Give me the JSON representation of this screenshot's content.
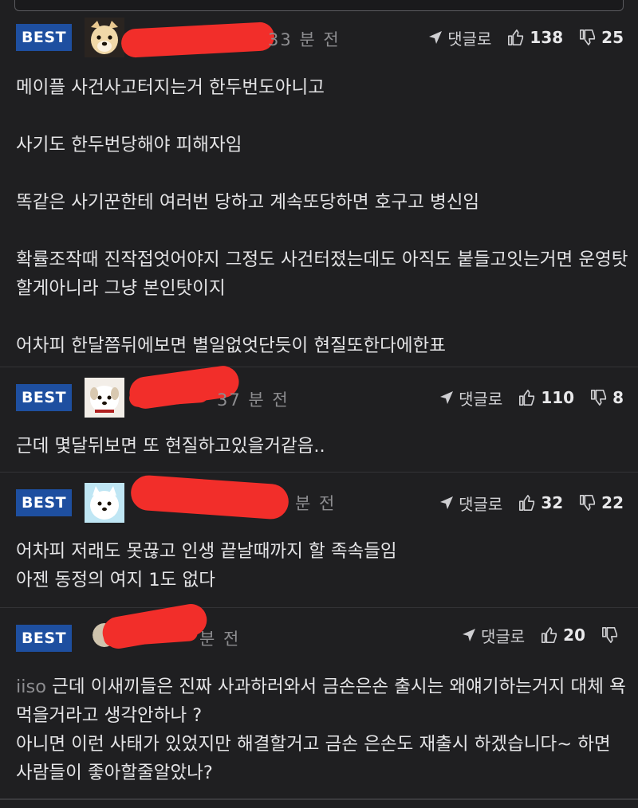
{
  "comments": [
    {
      "badge": "BEST",
      "time": "33 분 전",
      "reply_label": "댓글로",
      "likes": "138",
      "dislikes": "25",
      "avatar": "dog-avatar-1",
      "text": "메이플 사건사고터지는거 한두번도아니고\n\n사기도 한두번당해야 피해자임\n\n똑같은 사기꾼한테 여러번 당하고 계속또당하면 호구고 병신임\n\n확률조작때 진작접엇어야지 그정도 사건터졌는데도 아직도 붙들고잇는거면 운영탓할게아니라 그냥 본인탓이지\n\n어차피 한달쯤뒤에보면 별일없엇단듯이 현질또한다에한표"
    },
    {
      "badge": "BEST",
      "time": "37 분 전",
      "reply_label": "댓글로",
      "likes": "110",
      "dislikes": "8",
      "avatar": "dog-avatar-2",
      "text": "근데 몇달뒤보면 또 현질하고있을거같음.."
    },
    {
      "badge": "BEST",
      "time": "분 전",
      "reply_label": "댓글로",
      "likes": "32",
      "dislikes": "22",
      "avatar": "dog-avatar-3",
      "text": "어차피 저래도 못끊고 인생 끝날때까지 할 족속들임\n아젠 동정의 여지 1도 없다"
    },
    {
      "badge": "BEST",
      "time": "분 전",
      "reply_label": "댓글로",
      "likes": "20",
      "dislikes": "",
      "avatar": "user-avatar-4",
      "nick_prefix": "iiso",
      "text": " 근데 이새끼들은 진짜 사과하러와서 금손은손 출시는 왜얘기하는거지 대체 욕먹을거라고 생각안하나 ?\n아니면 이런 사태가 있었지만 해결할거고 금손 은손도 재출시 하겠습니다~ 하면 사람들이 좋아할줄알았나?"
    }
  ]
}
